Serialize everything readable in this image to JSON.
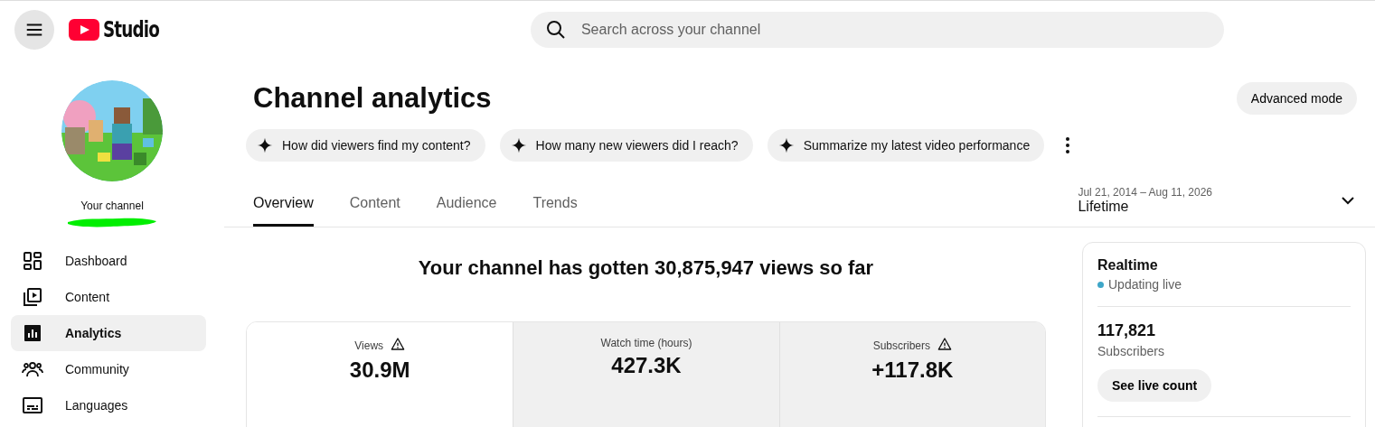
{
  "header": {
    "logo_text": "Studio",
    "search": {
      "placeholder": "Search across your channel"
    }
  },
  "sidebar": {
    "channel_label": "Your channel",
    "items": [
      {
        "label": "Dashboard",
        "kind": "dashboard",
        "selected": false
      },
      {
        "label": "Content",
        "kind": "content",
        "selected": false
      },
      {
        "label": "Analytics",
        "kind": "analytics",
        "selected": true
      },
      {
        "label": "Community",
        "kind": "community",
        "selected": false
      },
      {
        "label": "Languages",
        "kind": "languages",
        "selected": false
      }
    ]
  },
  "page": {
    "title": "Channel analytics",
    "advanced_button": "Advanced mode",
    "suggestions": [
      "How did viewers find my content?",
      "How many new viewers did I reach?",
      "Summarize my latest video performance"
    ],
    "tabs": [
      {
        "label": "Overview",
        "selected": true
      },
      {
        "label": "Content",
        "selected": false
      },
      {
        "label": "Audience",
        "selected": false
      },
      {
        "label": "Trends",
        "selected": false
      }
    ],
    "date_range": {
      "dates": "Jul 21, 2014 – Aug 11, 2026",
      "period": "Lifetime"
    },
    "summary": "Your channel has gotten 30,875,947 views so far",
    "metrics": [
      {
        "label": "Views",
        "value": "30.9M",
        "warning": true,
        "selected": true
      },
      {
        "label": "Watch time (hours)",
        "value": "427.3K",
        "warning": false,
        "selected": false
      },
      {
        "label": "Subscribers",
        "value": "+117.8K",
        "warning": true,
        "selected": false
      }
    ]
  },
  "realtime": {
    "title": "Realtime",
    "status": "Updating live",
    "count": "117,821",
    "count_label": "Subscribers",
    "button": "See live count"
  }
}
